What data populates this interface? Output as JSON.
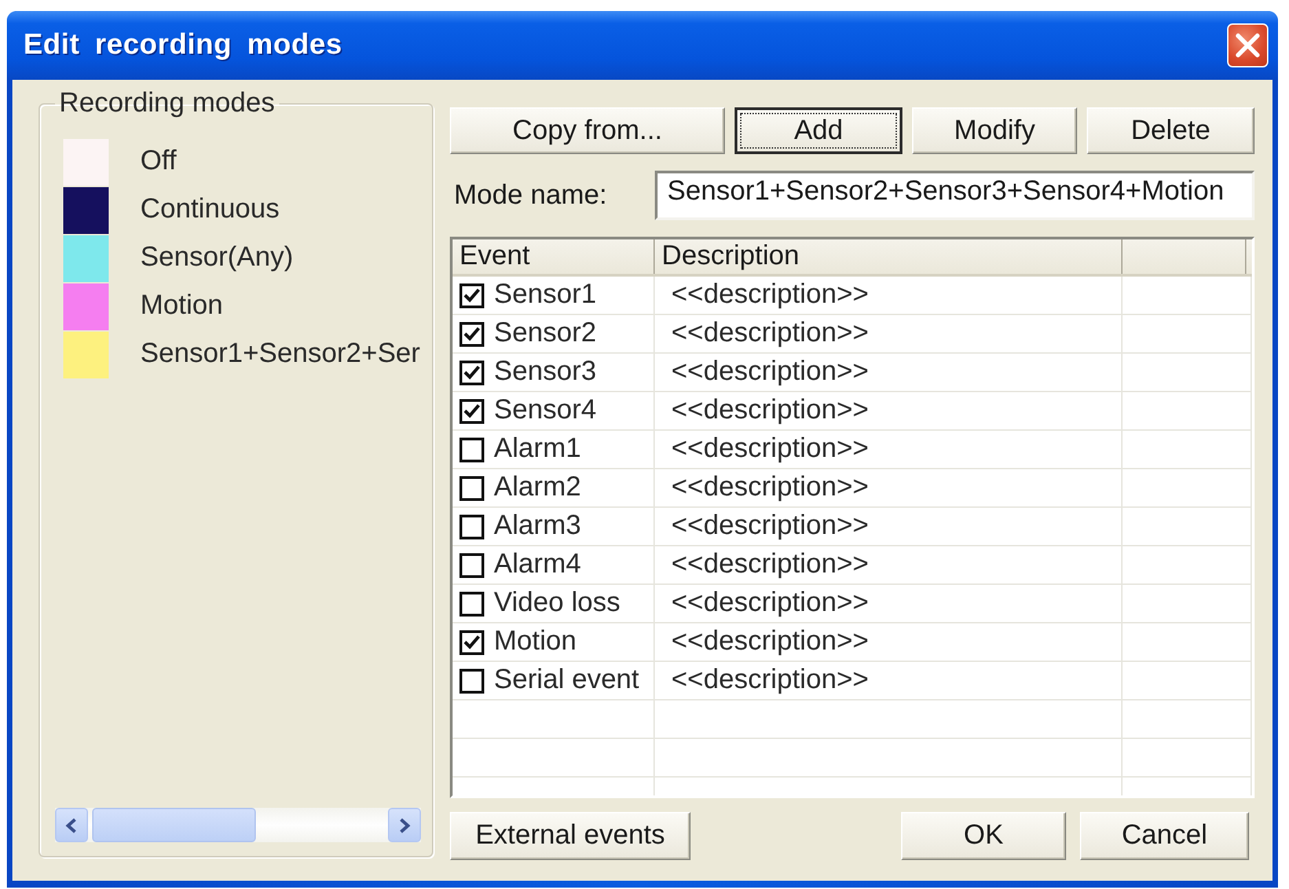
{
  "window": {
    "title": "Edit recording modes"
  },
  "recording_modes": {
    "title": "Recording modes",
    "items": [
      {
        "label": "Off",
        "color": "#fcf4f4"
      },
      {
        "label": "Continuous",
        "color": "#15105e"
      },
      {
        "label": "Sensor(Any)",
        "color": "#7ee8ec"
      },
      {
        "label": "Motion",
        "color": "#f57ef0"
      },
      {
        "label": "Sensor1+Sensor2+Ser",
        "color": "#fdf17f"
      }
    ]
  },
  "top_buttons": [
    {
      "label": "Copy from...",
      "focused": false
    },
    {
      "label": "Add",
      "focused": true
    },
    {
      "label": "Modify",
      "focused": false
    },
    {
      "label": "Delete",
      "focused": false
    }
  ],
  "mode_name": {
    "label": "Mode name:",
    "value": "Sensor1+Sensor2+Sensor3+Sensor4+Motion"
  },
  "table": {
    "columns": [
      "Event",
      "Description"
    ],
    "rows": [
      {
        "event": "Sensor1",
        "checked": true,
        "description": "<<description>>"
      },
      {
        "event": "Sensor2",
        "checked": true,
        "description": "<<description>>"
      },
      {
        "event": "Sensor3",
        "checked": true,
        "description": "<<description>>"
      },
      {
        "event": "Sensor4",
        "checked": true,
        "description": "<<description>>"
      },
      {
        "event": "Alarm1",
        "checked": false,
        "description": "<<description>>"
      },
      {
        "event": "Alarm2",
        "checked": false,
        "description": "<<description>>"
      },
      {
        "event": "Alarm3",
        "checked": false,
        "description": "<<description>>"
      },
      {
        "event": "Alarm4",
        "checked": false,
        "description": "<<description>>"
      },
      {
        "event": "Video loss",
        "checked": false,
        "description": "<<description>>"
      },
      {
        "event": "Motion",
        "checked": true,
        "description": "<<description>>"
      },
      {
        "event": "Serial event",
        "checked": false,
        "description": "<<description>>"
      }
    ]
  },
  "footer": {
    "left_buttons": [
      "External events"
    ],
    "right_buttons": [
      "OK",
      "Cancel"
    ]
  }
}
